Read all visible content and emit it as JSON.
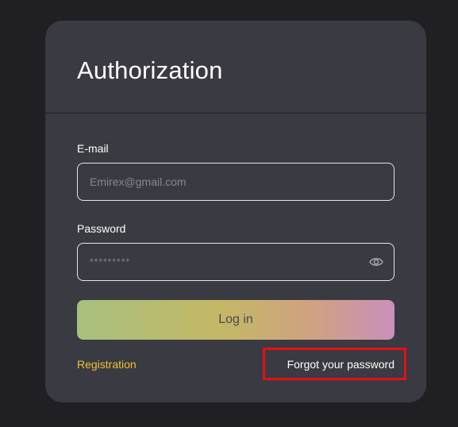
{
  "card": {
    "title": "Authorization"
  },
  "email": {
    "label": "E-mail",
    "placeholder": "Emirex@gmail.com",
    "value": ""
  },
  "password": {
    "label": "Password",
    "placeholder": "*********",
    "value": "",
    "toggle_icon": "eye-icon"
  },
  "actions": {
    "login_label": "Log in",
    "registration_label": "Registration",
    "forgot_label": "Forgot your password"
  },
  "colors": {
    "background": "#1f1f24",
    "card": "#3a3a42",
    "link_accent": "#f1c232",
    "highlight": "#e80f12",
    "button_gradient": [
      "#a6c07e",
      "#c4b865",
      "#d0a183",
      "#c98fbb"
    ]
  }
}
